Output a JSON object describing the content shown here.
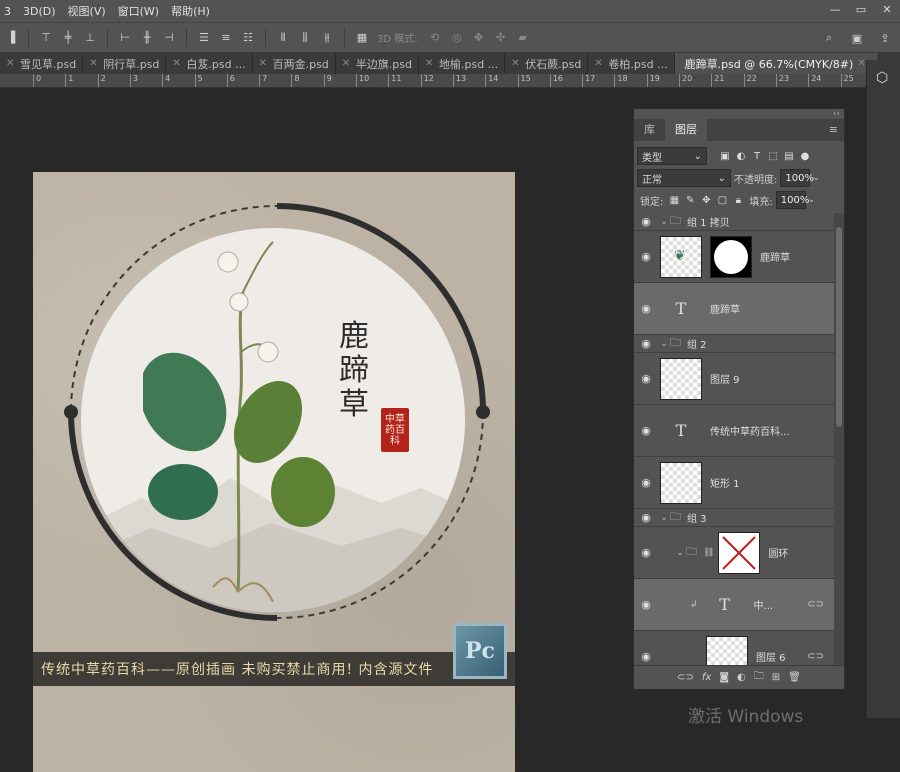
{
  "menubar": {
    "items": [
      "3",
      "3D(D)",
      "视图(V)",
      "窗口(W)",
      "帮助(H)"
    ],
    "window_controls": [
      "—",
      "▭",
      "✕"
    ]
  },
  "options": {
    "mode_3d_label": "3D 模式:"
  },
  "tabs": [
    {
      "label": "雪见草.psd"
    },
    {
      "label": "阴行草.psd"
    },
    {
      "label": "白芨.psd ..."
    },
    {
      "label": "百两金.psd"
    },
    {
      "label": "半边旗.psd"
    },
    {
      "label": "地榆.psd ..."
    },
    {
      "label": "伏石蕨.psd"
    },
    {
      "label": "卷柏.psd ..."
    },
    {
      "label": "鹿蹄草.psd @ 66.7%(CMYK/8#)",
      "active": true
    }
  ],
  "ruler": {
    "labels": [
      "0",
      "1",
      "2",
      "3",
      "4",
      "5",
      "6",
      "7",
      "8",
      "9",
      "10",
      "11",
      "12",
      "13",
      "14",
      "15",
      "16",
      "17",
      "18",
      "19",
      "20",
      "21",
      "22",
      "23",
      "24",
      "25"
    ]
  },
  "artwork": {
    "title_vertical": "鹿蹄草",
    "seal_text": "中草药百科",
    "bottom_text": "传统中草药百科——原创插画 未购买禁止商用! 内含源文件",
    "logo_text": "Pc"
  },
  "layers_panel": {
    "tabs": [
      "库",
      "图层"
    ],
    "active_tab": "图层",
    "filter_label": "类型",
    "blend_mode": "正常",
    "opacity_label": "不透明度:",
    "opacity_value": "100%",
    "lock_label": "锁定:",
    "fill_label": "填充:",
    "fill_value": "100%",
    "layers": [
      {
        "kind": "group",
        "name": "组 1 拷贝"
      },
      {
        "kind": "image-mask",
        "name": "鹿蹄草"
      },
      {
        "kind": "text",
        "name": "鹿蹄草",
        "selected": true
      },
      {
        "kind": "group",
        "name": "组 2"
      },
      {
        "kind": "image",
        "name": "图层 9"
      },
      {
        "kind": "text",
        "name": "传统中草药百科..."
      },
      {
        "kind": "image",
        "name": "矩形 1"
      },
      {
        "kind": "group",
        "name": "组 3"
      },
      {
        "kind": "group-mask",
        "name": "圆环"
      },
      {
        "kind": "text",
        "name": "中...",
        "selected": true
      },
      {
        "kind": "image",
        "name": "图层 6"
      }
    ]
  },
  "watermark": "激活 Windows"
}
